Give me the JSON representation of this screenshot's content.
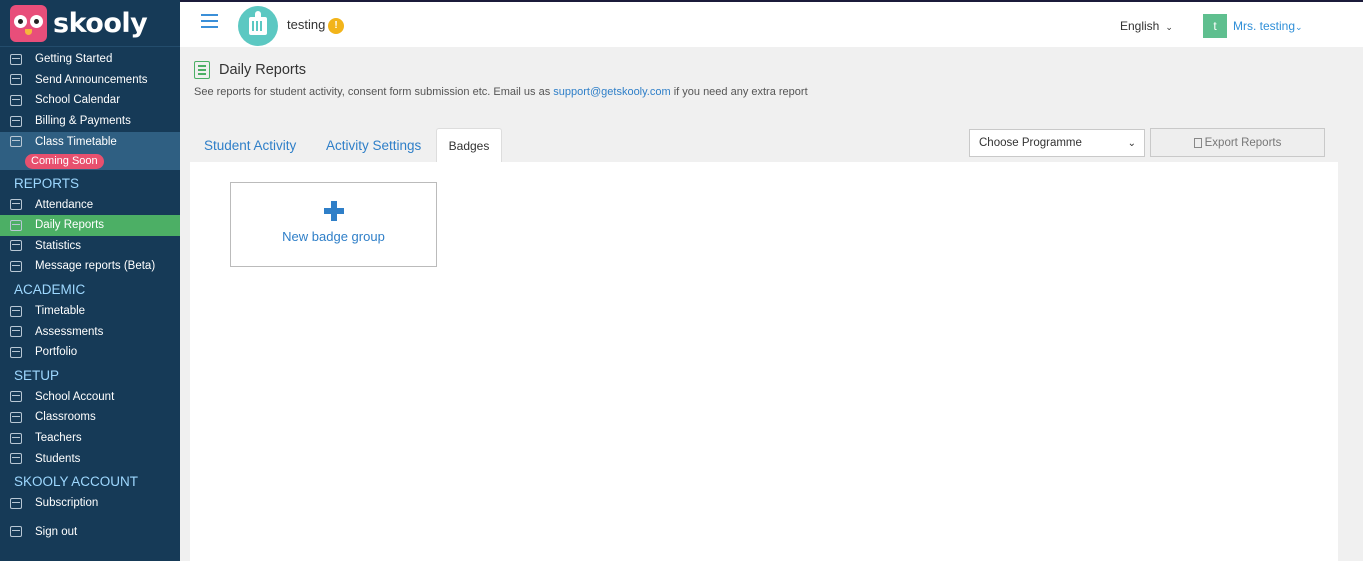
{
  "app": {
    "name": "skooly"
  },
  "sidebar": {
    "top_items": [
      {
        "label": "Getting Started"
      },
      {
        "label": "Send Announcements"
      },
      {
        "label": "School Calendar"
      },
      {
        "label": "Billing & Payments"
      }
    ],
    "timetable": {
      "label": "Class Timetable",
      "badge": "Coming Soon"
    },
    "reports_title": "REPORTS",
    "reports": [
      {
        "label": "Attendance"
      },
      {
        "label": "Daily Reports"
      },
      {
        "label": "Statistics"
      },
      {
        "label": "Message reports (Beta)"
      }
    ],
    "academic_title": "ACADEMIC",
    "academic": [
      {
        "label": "Timetable"
      },
      {
        "label": "Assessments"
      },
      {
        "label": "Portfolio"
      }
    ],
    "setup_title": "SETUP",
    "setup": [
      {
        "label": "School Account"
      },
      {
        "label": "Classrooms"
      },
      {
        "label": "Teachers"
      },
      {
        "label": "Students"
      }
    ],
    "account_title": "SKOOLY ACCOUNT",
    "account": [
      {
        "label": "Subscription"
      },
      {
        "label": "Sign out"
      }
    ]
  },
  "header": {
    "school_name": "testing",
    "warning_badge": "!",
    "language": "English",
    "user_initial": "t",
    "user_name": "Mrs. testing"
  },
  "page": {
    "title": "Daily Reports",
    "description_prefix": "See reports for student activity, consent form submission etc. Email us as",
    "support_email": "support@getskooly.com",
    "description_suffix": "if you need any extra report"
  },
  "tabs": [
    {
      "label": "Student Activity"
    },
    {
      "label": "Activity Settings"
    },
    {
      "label": "Badges"
    }
  ],
  "programme_select": {
    "value": "Choose Programme"
  },
  "export_button": {
    "label": "Export Reports"
  },
  "badge_card": {
    "label": "New badge group"
  },
  "colors": {
    "sidebar_bg": "#163a57",
    "active_green": "#4caf65",
    "link_blue": "#2f7fc8",
    "coming_soon_pink": "#e8506e"
  }
}
